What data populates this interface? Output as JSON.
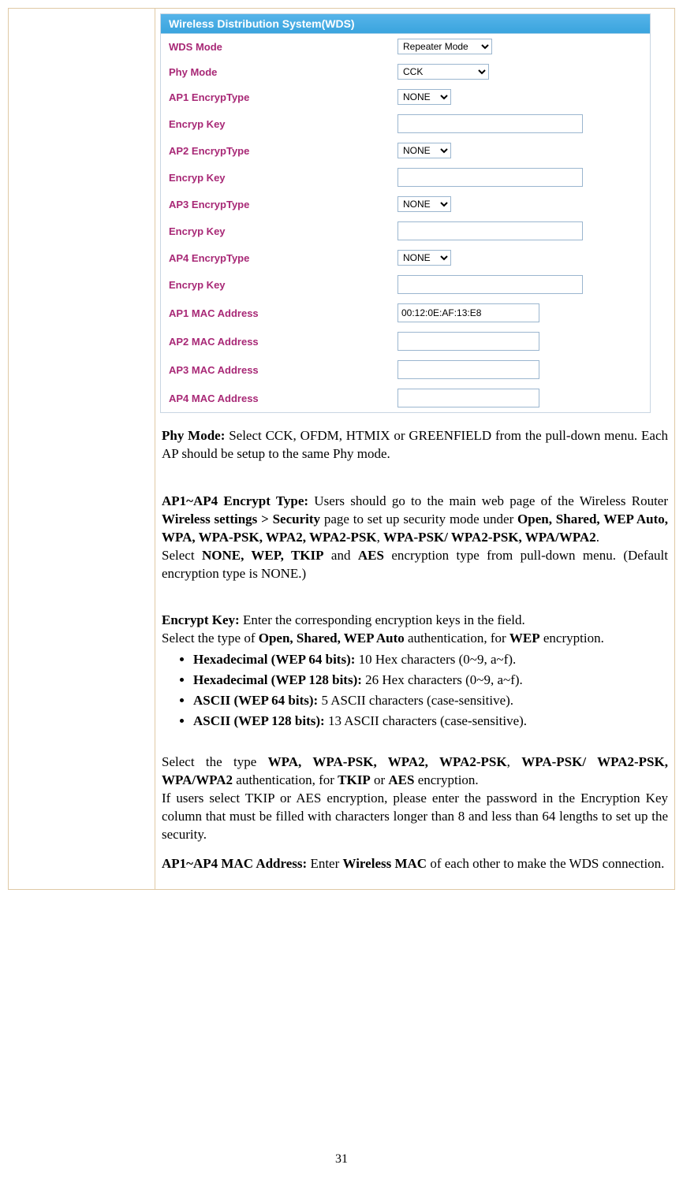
{
  "panel": {
    "header": "Wireless Distribution System(WDS)",
    "rows": {
      "wds_mode_label": "WDS Mode",
      "wds_mode_value": "Repeater Mode",
      "phy_mode_label": "Phy Mode",
      "phy_mode_value": "CCK",
      "ap1_enc_label": "AP1 EncrypType",
      "ap1_enc_value": "NONE",
      "key1_label": "Encryp Key",
      "key1_value": "",
      "ap2_enc_label": "AP2 EncrypType",
      "ap2_enc_value": "NONE",
      "key2_label": "Encryp Key",
      "key2_value": "",
      "ap3_enc_label": "AP3 EncrypType",
      "ap3_enc_value": "NONE",
      "key3_label": "Encryp Key",
      "key3_value": "",
      "ap4_enc_label": "AP4 EncrypType",
      "ap4_enc_value": "NONE",
      "key4_label": "Encryp Key",
      "key4_value": "",
      "mac1_label": "AP1 MAC Address",
      "mac1_value": "00:12:0E:AF:13:E8",
      "mac2_label": "AP2 MAC Address",
      "mac2_value": "",
      "mac3_label": "AP3 MAC Address",
      "mac3_value": "",
      "mac4_label": "AP4 MAC Address",
      "mac4_value": ""
    }
  },
  "doc": {
    "phy_mode_label": "Phy Mode:",
    "phy_mode_rest": " Select CCK, OFDM, HTMIX or GREENFIELD from the pull-down menu. Each AP should be setup to the same Phy mode.",
    "enc_type_label": "AP1~AP4 Encrypt Type:",
    "enc_type_1": " Users should go to the main web page of the Wireless  Router ",
    "enc_type_path": "Wireless settings > Security",
    "enc_type_2": " page to set up security mode under ",
    "enc_type_modes": "Open, Shared, WEP Auto, WPA, WPA-PSK, WPA2, WPA2-PSK",
    "enc_type_3": ", ",
    "enc_type_modes2": "WPA-PSK/ WPA2-PSK, WPA/WPA2",
    "enc_type_4": ".\nSelect ",
    "enc_type_nwk": "NONE, WEP, TKIP",
    "enc_type_5": " and ",
    "enc_type_aes": "AES",
    "enc_type_6": "  encryption type from pull-down menu. (Default encryption type is NONE.)",
    "key_label": "Encrypt Key:",
    "key_1": " Enter the corresponding encryption keys in the field.\nSelect the type of ",
    "key_modes": "Open, Shared, WEP Auto",
    "key_2": " authentication, for ",
    "key_wep": "WEP",
    "key_3": " encryption.",
    "li1_b": "Hexadecimal (WEP 64 bits):",
    "li1_r": " 10 Hex characters (0~9, a~f).",
    "li2_b": "Hexadecimal (WEP 128 bits):",
    "li2_r": " 26 Hex characters (0~9, a~f).",
    "li3_b": "ASCII (WEP 64 bits):",
    "li3_r": " 5 ASCII characters (case-sensitive).",
    "li4_b": "ASCII (WEP 128 bits):",
    "li4_r": " 13 ASCII characters (case-sensitive).",
    "post_list_1": "Select the type ",
    "post_list_modes": "WPA, WPA-PSK, WPA2, WPA2-PSK",
    "post_list_2": ", ",
    "post_list_modes2": "WPA-PSK/ WPA2-PSK, WPA/WPA2",
    "post_list_3": " authentication, for  ",
    "post_list_tkip": "TKIP",
    "post_list_4": " or ",
    "post_list_aes": "AES",
    "post_list_5": " encryption.\nIf users select TKIP or AES encryption, please enter the password in the Encryption Key column that must be filled with characters longer than 8 and less than 64 lengths to set up the security.",
    "mac_label": "AP1~AP4 MAC Address:",
    "mac_1": " Enter ",
    "mac_wireless": "Wireless MAC",
    "mac_2": " of each other to make the WDS connection."
  },
  "page_number": "31"
}
